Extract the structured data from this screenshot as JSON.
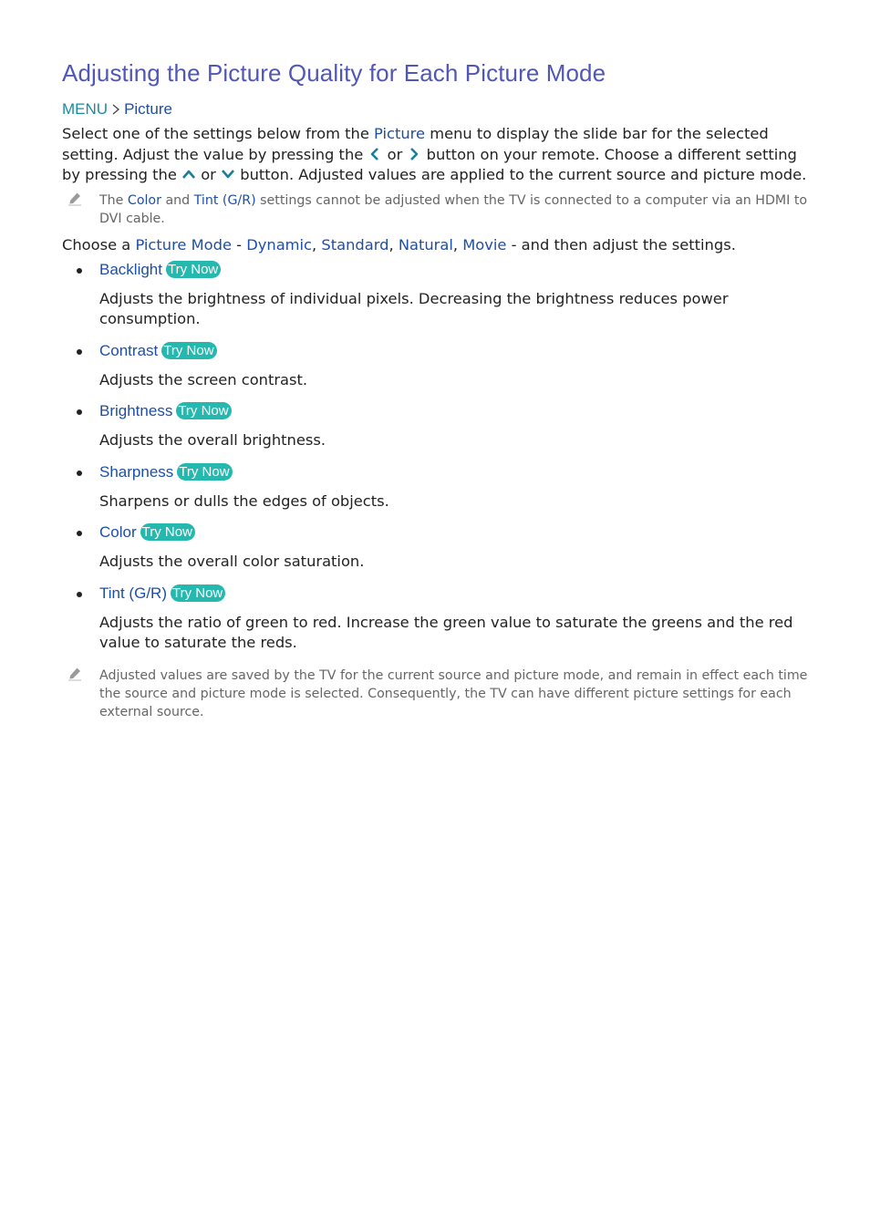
{
  "colors": {
    "title": "#5157b6",
    "link_blue": "#1e4fa6",
    "menu_teal": "#1a8ba3",
    "try_now_bg": "#25b8ae",
    "body_text": "#222222",
    "note_text": "#666666"
  },
  "page": {
    "title": "Adjusting the Picture Quality for Each Picture Mode",
    "breadcrumb": {
      "menu": "MENU",
      "separator_icon": "chevron-right-icon",
      "item": "Picture"
    },
    "intro": {
      "part1": "Select one of the settings below from the ",
      "picture": "Picture",
      "part2": " menu to display the slide bar for the selected setting. Adjust the value by pressing the ",
      "or1": " or ",
      "part3": " button on your remote. Choose a different setting by pressing the ",
      "or2": " or ",
      "part4": " button. Adjusted values are applied to the current source and picture mode.",
      "icons": [
        "chevron-left-icon",
        "chevron-right-icon",
        "chevron-up-icon",
        "chevron-down-icon"
      ]
    },
    "note1": {
      "icon": "pencil-icon",
      "part1": "The ",
      "color": "Color",
      "part2": " and ",
      "tint": "Tint (G/R)",
      "part3": " settings cannot be adjusted when the TV is connected to a computer via an HDMI to DVI cable."
    },
    "choose": {
      "part1": "Choose a ",
      "picture_mode": "Picture Mode",
      "dash1": " - ",
      "modes": [
        "Dynamic",
        "Standard",
        "Natural",
        "Movie"
      ],
      "sep": ", ",
      "dash2": " - ",
      "part2": "and then adjust the settings."
    },
    "try_now_label": "Try Now",
    "settings": [
      {
        "title": "Backlight",
        "description": "Adjusts the brightness of individual pixels. Decreasing the brightness reduces power consumption."
      },
      {
        "title": "Contrast",
        "description": "Adjusts the screen contrast."
      },
      {
        "title": "Brightness",
        "description": "Adjusts the overall brightness."
      },
      {
        "title": "Sharpness",
        "description": "Sharpens or dulls the edges of objects."
      },
      {
        "title": "Color",
        "description": "Adjusts the overall color saturation."
      },
      {
        "title": "Tint (G/R)",
        "description": "Adjusts the ratio of green to red. Increase the green value to saturate the greens and the red value to saturate the reds."
      }
    ],
    "note2": {
      "icon": "pencil-icon",
      "text": "Adjusted values are saved by the TV for the current source and picture mode, and remain in effect each time the source and picture mode is selected. Consequently, the TV can have different picture settings for each external source."
    }
  }
}
